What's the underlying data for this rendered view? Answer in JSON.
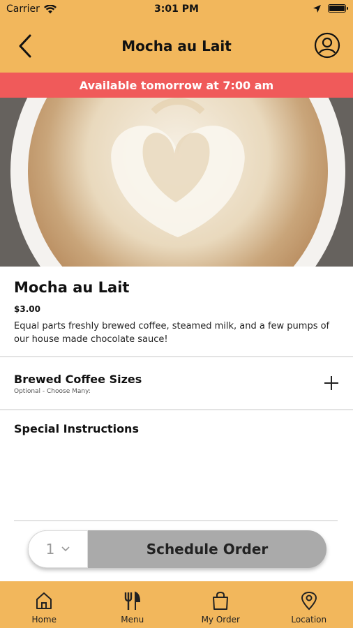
{
  "status_bar": {
    "carrier": "Carrier",
    "time": "3:01 PM"
  },
  "header": {
    "title": "Mocha au Lait",
    "icons": {
      "back": "chevron-left-icon",
      "profile": "user-circle-icon"
    }
  },
  "banner": {
    "text": "Available tomorrow at 7:00 am"
  },
  "item": {
    "name": "Mocha au Lait",
    "price": "$3.00",
    "description": "Equal parts freshly brewed coffee, steamed milk, and a few pumps of our house made chocolate sauce!"
  },
  "options": [
    {
      "title": "Brewed Coffee Sizes",
      "subtitle": "Optional - Choose Many:",
      "icon": "plus-icon"
    }
  ],
  "special_instructions": {
    "label": "Special Instructions"
  },
  "order": {
    "quantity": "1",
    "button_label": "Schedule Order"
  },
  "tabs": [
    {
      "label": "Home",
      "icon": "home-icon"
    },
    {
      "label": "Menu",
      "icon": "fork-knife-icon"
    },
    {
      "label": "My Order",
      "icon": "shopping-bag-icon"
    },
    {
      "label": "Location",
      "icon": "location-pin-icon"
    }
  ],
  "colors": {
    "header": "#F2B75C",
    "banner": "#F05A5A",
    "button": "#AAAAAA"
  }
}
